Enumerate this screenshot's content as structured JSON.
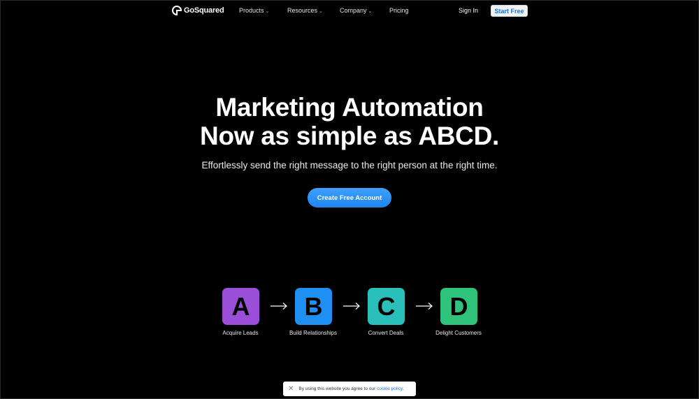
{
  "nav": {
    "brand": "GoSquared",
    "links": [
      {
        "label": "Products",
        "has_dropdown": true
      },
      {
        "label": "Resources",
        "has_dropdown": true
      },
      {
        "label": "Company",
        "has_dropdown": true
      },
      {
        "label": "Pricing",
        "has_dropdown": false
      }
    ],
    "sign_in": "Sign In",
    "start_free": "Start Free",
    "dropdown_glyph": "⌄"
  },
  "hero": {
    "title_line1": "Marketing Automation",
    "title_line2": "Now as simple as ABCD.",
    "subtitle": "Effortlessly send the right message to the right person at the right time.",
    "cta": "Create Free Account"
  },
  "steps": [
    {
      "letter": "A",
      "label": "Acquire Leads",
      "color": "#9b4fd9"
    },
    {
      "letter": "B",
      "label": "Build Relationships",
      "color": "#1f8ff2"
    },
    {
      "letter": "C",
      "label": "Convert Deals",
      "color": "#2bbfb9"
    },
    {
      "letter": "D",
      "label": "Delight Customers",
      "color": "#2ec27a"
    }
  ],
  "cookie": {
    "text": "By using this website you agree to our ",
    "link": "cookie policy",
    "suffix": ".",
    "close_icon": "close-icon"
  },
  "colors": {
    "background": "#000000",
    "accent": "#1e86f0"
  }
}
